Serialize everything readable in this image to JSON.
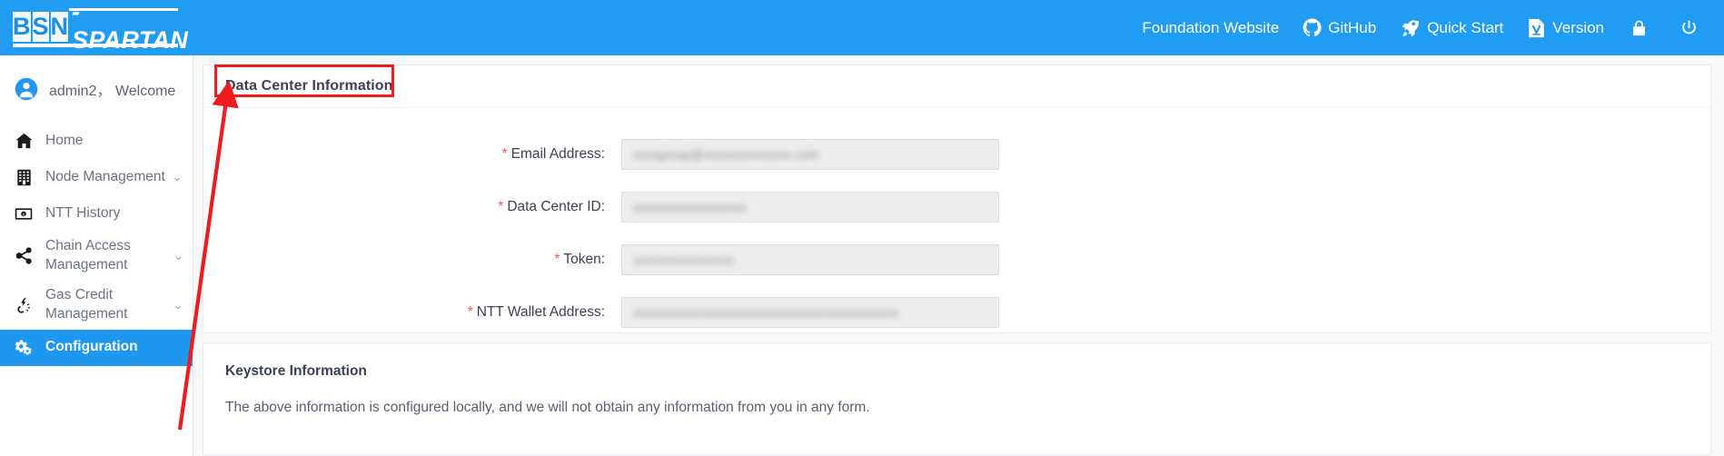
{
  "brand": {
    "letters": [
      "B",
      "S",
      "N"
    ],
    "word": "-SPARTAN",
    "accent": "#209cf2"
  },
  "topbar": {
    "items": [
      {
        "label": "Foundation Website",
        "icon": "none"
      },
      {
        "label": "GitHub",
        "icon": "github-icon"
      },
      {
        "label": "Quick Start",
        "icon": "rocket-icon"
      },
      {
        "label": "Version",
        "icon": "document-icon"
      }
    ],
    "lock_icon": "lock-icon",
    "power_icon": "power-icon"
  },
  "sidebar": {
    "user": "admin2， Welcome",
    "items": [
      {
        "label": "Home",
        "icon": "home-icon",
        "chevron": "",
        "active": false
      },
      {
        "label": "Node Management",
        "icon": "building-icon",
        "chevron": "⌄",
        "active": false
      },
      {
        "label": "NTT History",
        "icon": "banknote-icon",
        "chevron": "",
        "active": false
      },
      {
        "label": "Chain Access Management",
        "icon": "share-icon",
        "chevron": "⌄",
        "active": false
      },
      {
        "label": "Gas Credit Management",
        "icon": "gas-icon",
        "chevron": "⌄",
        "active": false
      },
      {
        "label": "Configuration",
        "icon": "gears-icon",
        "chevron": "",
        "active": true
      }
    ]
  },
  "main": {
    "data_center_card": {
      "title": "Data Center Information",
      "fields": [
        {
          "label": "Email Address:",
          "required": true,
          "value": "xxxxgroup@xxxxxxxxxxxxxx.com",
          "masked": true
        },
        {
          "label": "Data Center ID:",
          "required": true,
          "value": "xxxxxxxxxxxxxxxxxx",
          "masked": true
        },
        {
          "label": "Token:",
          "required": true,
          "value": "xxxxxxxxxxxxxxxx",
          "masked": true
        },
        {
          "label": "NTT Wallet Address:",
          "required": true,
          "value": "xxxxxxxxxxxxxxxxxxxxxxxxxxxxxxxxxxxxxxxxxx",
          "masked": true
        }
      ]
    },
    "keystore_card": {
      "title": "Keystore Information",
      "text": "The above information is configured locally, and we will not obtain any information from you in any form."
    }
  },
  "annotation": {
    "color": "#ee1c1c",
    "box_target": "Data Center Information",
    "arrow_from": "Configuration",
    "arrow_to": "Data Center Information"
  }
}
